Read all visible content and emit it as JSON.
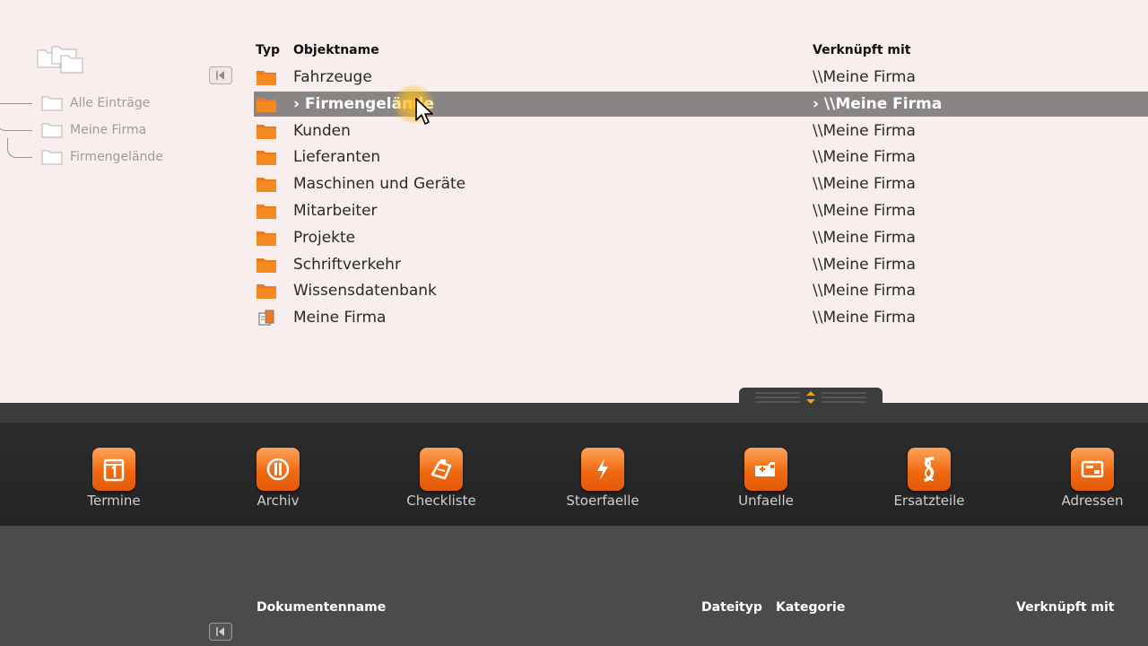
{
  "tree": {
    "items": [
      {
        "label": "Alle Einträge"
      },
      {
        "label": "Meine Firma"
      },
      {
        "label": "Firmengelände"
      }
    ]
  },
  "objects": {
    "headers": {
      "type": "Typ",
      "name": "Objektname",
      "linked": "Verknüpft mit"
    },
    "rows": [
      {
        "name": "Fahrzeuge",
        "linked": "\\\\Meine Firma",
        "icon": "folder-icon"
      },
      {
        "name": "› Firmengelände",
        "linked": "› \\\\Meine Firma",
        "icon": "folder-icon",
        "selected": true
      },
      {
        "name": "Kunden",
        "linked": "\\\\Meine Firma",
        "icon": "folder-icon"
      },
      {
        "name": "Lieferanten",
        "linked": "\\\\Meine Firma",
        "icon": "folder-icon"
      },
      {
        "name": "Maschinen und Geräte",
        "linked": "\\\\Meine Firma",
        "icon": "folder-icon"
      },
      {
        "name": "Mitarbeiter",
        "linked": "\\\\Meine Firma",
        "icon": "folder-icon"
      },
      {
        "name": "Projekte",
        "linked": "\\\\Meine Firma",
        "icon": "folder-icon"
      },
      {
        "name": "Schriftverkehr",
        "linked": "\\\\Meine Firma",
        "icon": "folder-icon"
      },
      {
        "name": "Wissensdatenbank",
        "linked": "\\\\Meine Firma",
        "icon": "folder-icon"
      },
      {
        "name": "Meine Firma",
        "linked": "\\\\Meine Firma",
        "icon": "company-icon"
      }
    ]
  },
  "toolbar": {
    "items": [
      {
        "label": "Termine",
        "icon": "calendar-icon"
      },
      {
        "label": "Archiv",
        "icon": "archive-icon"
      },
      {
        "label": "Checkliste",
        "icon": "checklist-icon"
      },
      {
        "label": "Stoerfaelle",
        "icon": "lightning-icon"
      },
      {
        "label": "Unfaelle",
        "icon": "ambulance-icon"
      },
      {
        "label": "Ersatzteile",
        "icon": "spare-parts-icon"
      },
      {
        "label": "Adressen",
        "icon": "address-book-icon"
      }
    ]
  },
  "documents": {
    "headers": {
      "name": "Dokumentenname",
      "filetype": "Dateityp",
      "category": "Kategorie",
      "linked": "Verknüpft mit"
    }
  },
  "colors": {
    "accent": "#f07a1e",
    "selection": "#8a8585",
    "background": "#f7eeed",
    "toolbar": "#262626"
  }
}
